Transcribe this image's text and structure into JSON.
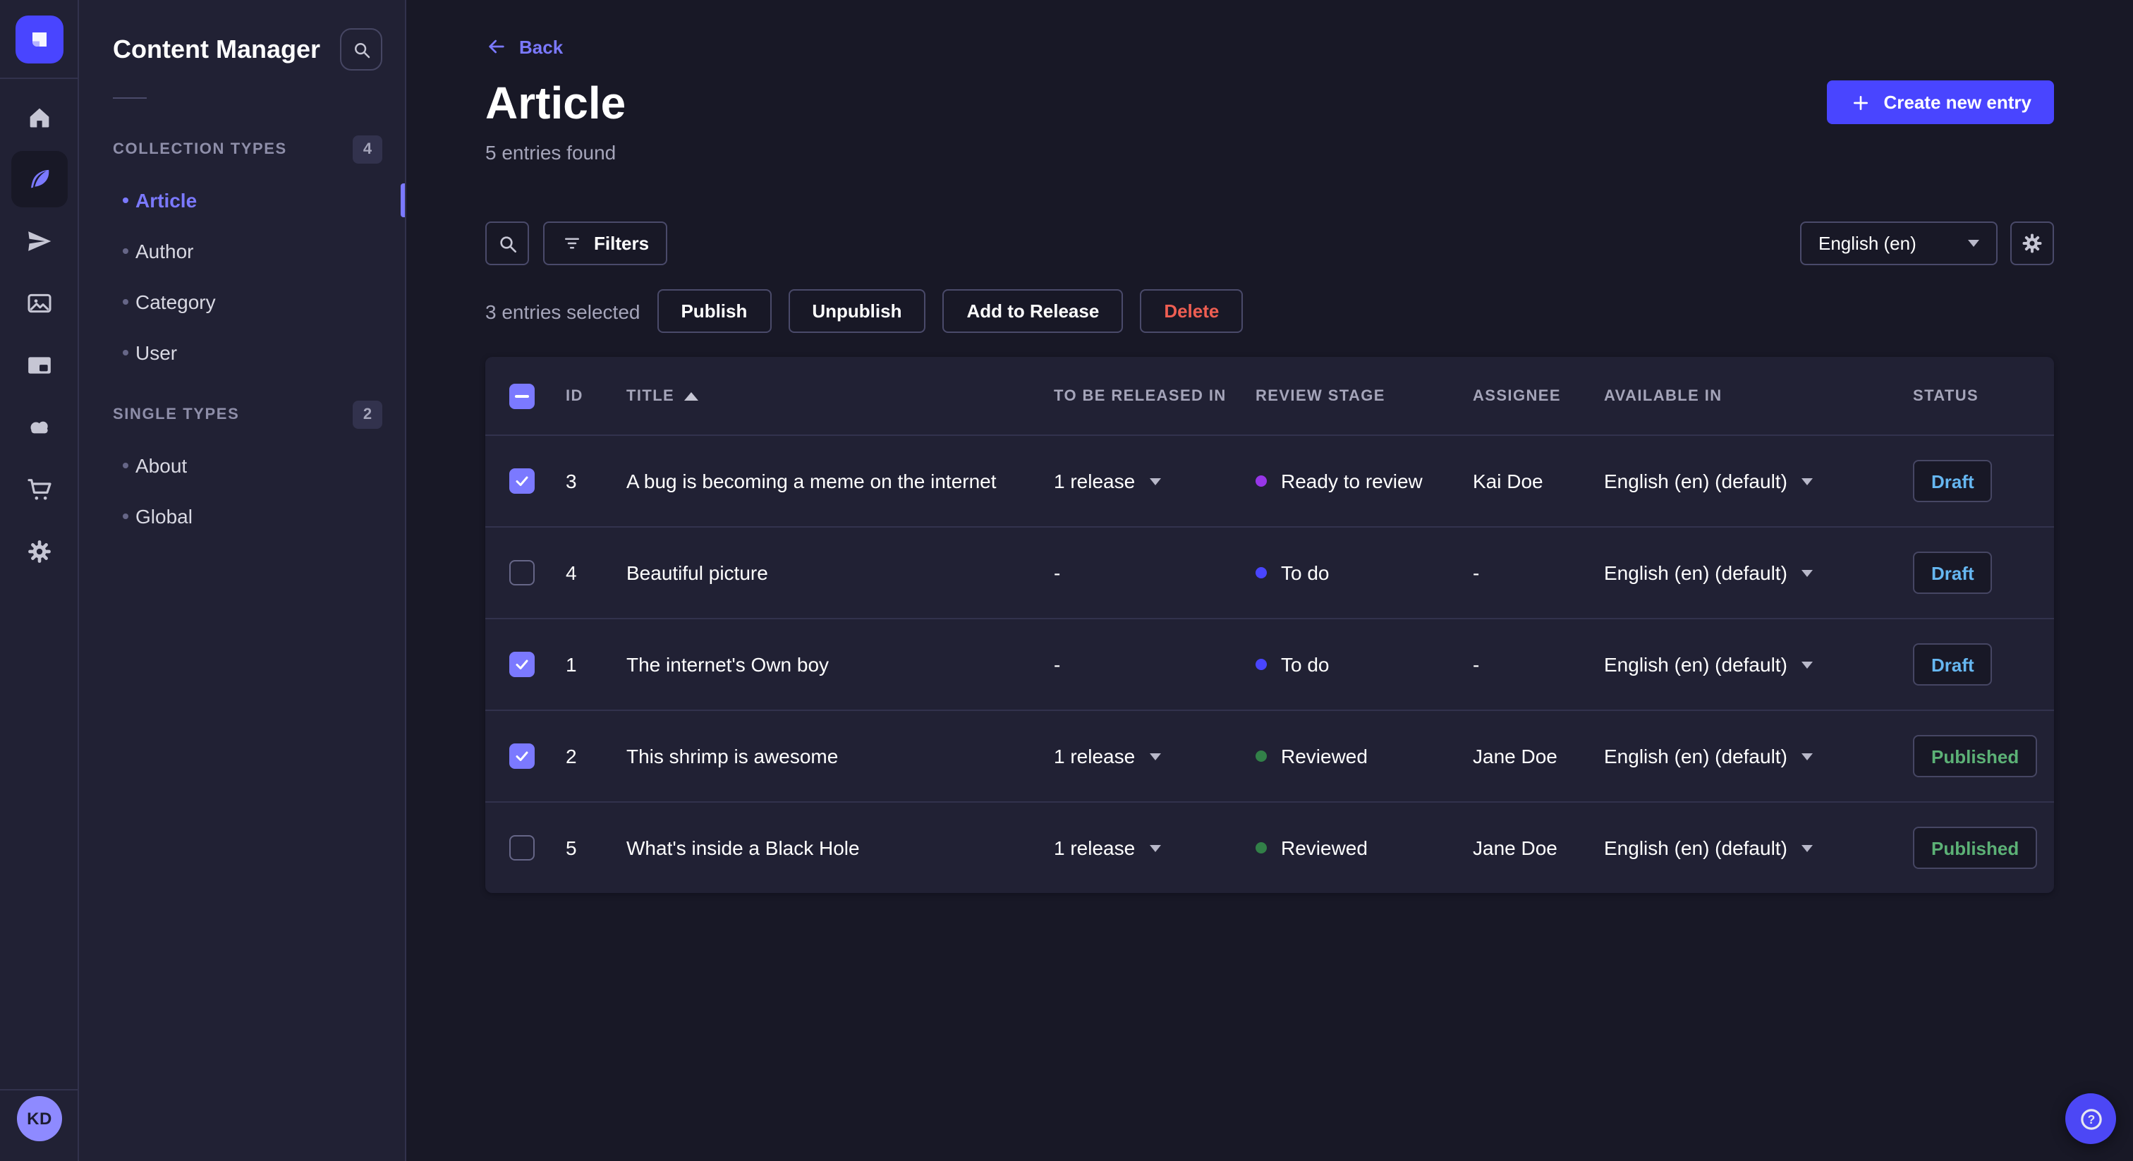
{
  "sidebar": {
    "logo_icon": "strapi-logo",
    "nav_icons": [
      "home",
      "content-manager",
      "releases",
      "media-library",
      "content-type-builder",
      "cloud",
      "marketplace",
      "settings"
    ],
    "active_icon": "content-manager",
    "avatar_initials": "KD"
  },
  "subnav": {
    "title": "Content Manager",
    "search_icon": "search",
    "sections": [
      {
        "label": "COLLECTION TYPES",
        "count": "4",
        "items": [
          {
            "label": "Article",
            "active": true
          },
          {
            "label": "Author",
            "active": false
          },
          {
            "label": "Category",
            "active": false
          },
          {
            "label": "User",
            "active": false
          }
        ]
      },
      {
        "label": "SINGLE TYPES",
        "count": "2",
        "items": [
          {
            "label": "About",
            "active": false
          },
          {
            "label": "Global",
            "active": false
          }
        ]
      }
    ]
  },
  "header": {
    "back_label": "Back",
    "title": "Article",
    "subtitle": "5 entries found",
    "create_button_label": "Create new entry"
  },
  "toolbar": {
    "search_icon": "search",
    "filters_label": "Filters",
    "locale_value": "English (en)",
    "settings_icon": "gear"
  },
  "selection": {
    "text": "3 entries selected",
    "publish_label": "Publish",
    "unpublish_label": "Unpublish",
    "add_to_release_label": "Add to Release",
    "delete_label": "Delete"
  },
  "table": {
    "sort_column": "TITLE",
    "sort_direction": "ascending",
    "columns": [
      "ID",
      "TITLE",
      "TO BE RELEASED IN",
      "REVIEW STAGE",
      "ASSIGNEE",
      "AVAILABLE IN",
      "STATUS"
    ],
    "rows": [
      {
        "checked": true,
        "id": "3",
        "title": "A bug is becoming a meme on the internet",
        "release": "1 release",
        "stage": "Ready to review",
        "stage_color": "#9736e8",
        "assignee": "Kai Doe",
        "locale": "English (en) (default)",
        "status": "Draft"
      },
      {
        "checked": false,
        "id": "4",
        "title": "Beautiful picture",
        "release": "-",
        "stage": "To do",
        "stage_color": "#4945ff",
        "assignee": "-",
        "locale": "English (en) (default)",
        "status": "Draft"
      },
      {
        "checked": true,
        "id": "1",
        "title": "The internet's Own boy",
        "release": "-",
        "stage": "To do",
        "stage_color": "#4945ff",
        "assignee": "-",
        "locale": "English (en) (default)",
        "status": "Draft"
      },
      {
        "checked": true,
        "id": "2",
        "title": "This shrimp is awesome",
        "release": "1 release",
        "stage": "Reviewed",
        "stage_color": "#328048",
        "assignee": "Jane Doe",
        "locale": "English (en) (default)",
        "status": "Published"
      },
      {
        "checked": false,
        "id": "5",
        "title": "What's inside a Black Hole",
        "release": "1 release",
        "stage": "Reviewed",
        "stage_color": "#328048",
        "assignee": "Jane Doe",
        "locale": "English (en) (default)",
        "status": "Published"
      }
    ]
  },
  "help": {
    "icon": "question-mark-circle"
  },
  "colors": {
    "page_bg": "#181826",
    "panel_bg": "#212134",
    "border": "#32324d",
    "button_border": "#4a4a6a",
    "primary": "#4945ff",
    "primary_light": "#7b79ff",
    "text_muted": "#a5a5ba",
    "danger": "#ee5e52",
    "status_draft": "#66b7f1",
    "status_published": "#5cb176",
    "stage_ready_to_review": "#9736e8",
    "stage_to_do": "#4945ff",
    "stage_reviewed": "#328048"
  }
}
